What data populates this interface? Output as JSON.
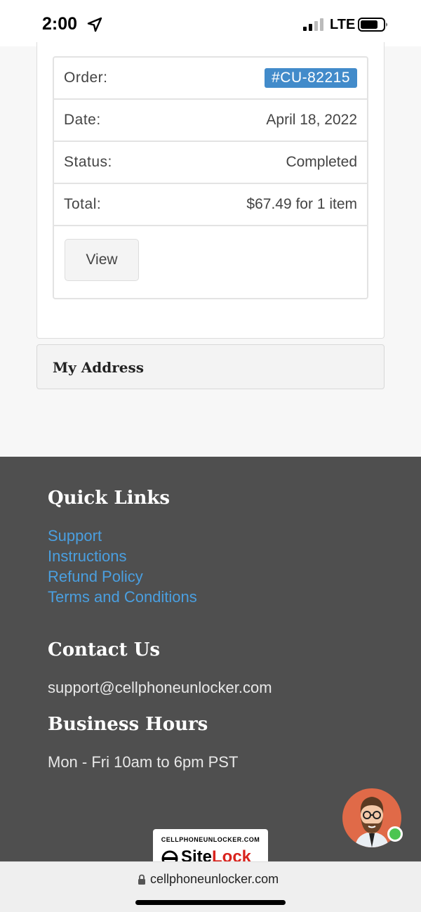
{
  "status_bar": {
    "time": "2:00",
    "network": "LTE"
  },
  "order": {
    "rows": [
      {
        "label": "Order:",
        "value": "#CU-82215"
      },
      {
        "label": "Date:",
        "value": "April 18, 2022"
      },
      {
        "label": "Status:",
        "value": "Completed"
      },
      {
        "label": "Total:",
        "value": "$67.49 for 1 item"
      }
    ],
    "view_label": "View",
    "badge_color": "#428bca"
  },
  "address": {
    "title": "My Address"
  },
  "footer": {
    "quick_links_title": "Quick Links",
    "links": [
      "Support",
      "Instructions",
      "Refund Policy",
      "Terms and Conditions"
    ],
    "contact_title": "Contact Us",
    "contact_email": "support@cellphoneunlocker.com",
    "hours_title": "Business Hours",
    "hours_text": "Mon - Fri 10am to 6pm PST",
    "link_color": "#4a9fe0",
    "background": "#4f4f4f"
  },
  "sitelock": {
    "domain": "CELLPHONEUNLOCKER.COM",
    "brand_a": "Site",
    "brand_b": "Lock"
  },
  "browser": {
    "url": "cellphoneunlocker.com"
  },
  "icons": {
    "location": "location-arrow-icon",
    "signal": "cellular-signal-icon",
    "battery": "battery-icon",
    "lock": "lock-icon",
    "chat": "chat-avatar-icon"
  }
}
